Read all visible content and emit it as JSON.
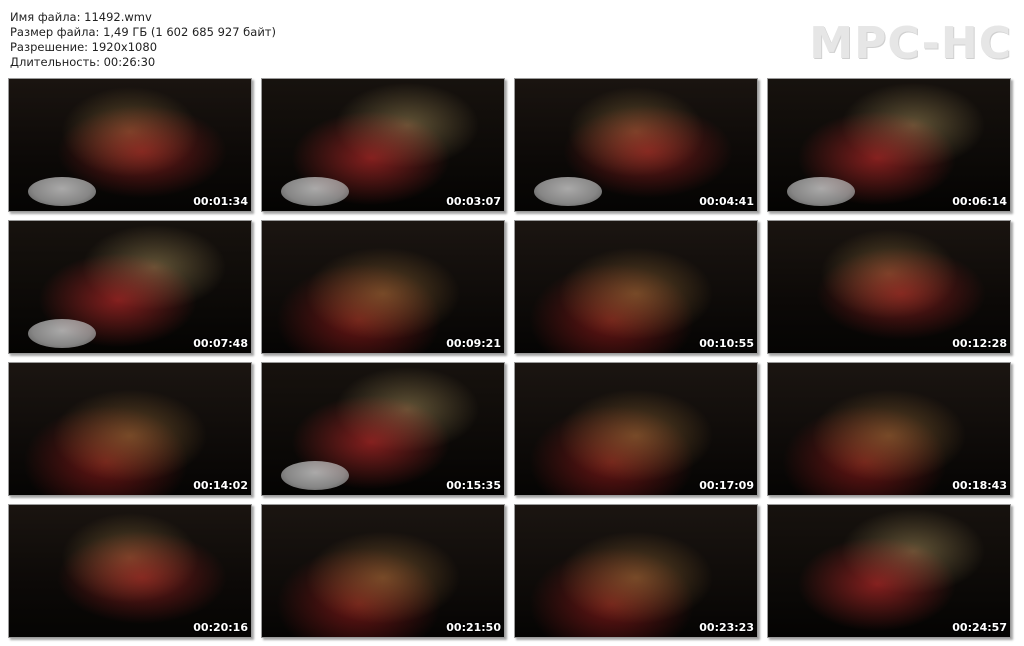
{
  "file_info": {
    "name_line": "Имя файла: 11492.wmv",
    "size_line": "Размер файла: 1,49 ГБ (1 602 685 927 байт)",
    "resolution_line": "Разрешение: 1920x1080",
    "duration_line": "Длительность: 00:26:30"
  },
  "logo": "MPC-HC",
  "thumbnails": [
    {
      "timestamp": "00:01:34"
    },
    {
      "timestamp": "00:03:07"
    },
    {
      "timestamp": "00:04:41"
    },
    {
      "timestamp": "00:06:14"
    },
    {
      "timestamp": "00:07:48"
    },
    {
      "timestamp": "00:09:21"
    },
    {
      "timestamp": "00:10:55"
    },
    {
      "timestamp": "00:12:28"
    },
    {
      "timestamp": "00:14:02"
    },
    {
      "timestamp": "00:15:35"
    },
    {
      "timestamp": "00:17:09"
    },
    {
      "timestamp": "00:18:43"
    },
    {
      "timestamp": "00:20:16"
    },
    {
      "timestamp": "00:21:50"
    },
    {
      "timestamp": "00:23:23"
    },
    {
      "timestamp": "00:24:57"
    }
  ]
}
